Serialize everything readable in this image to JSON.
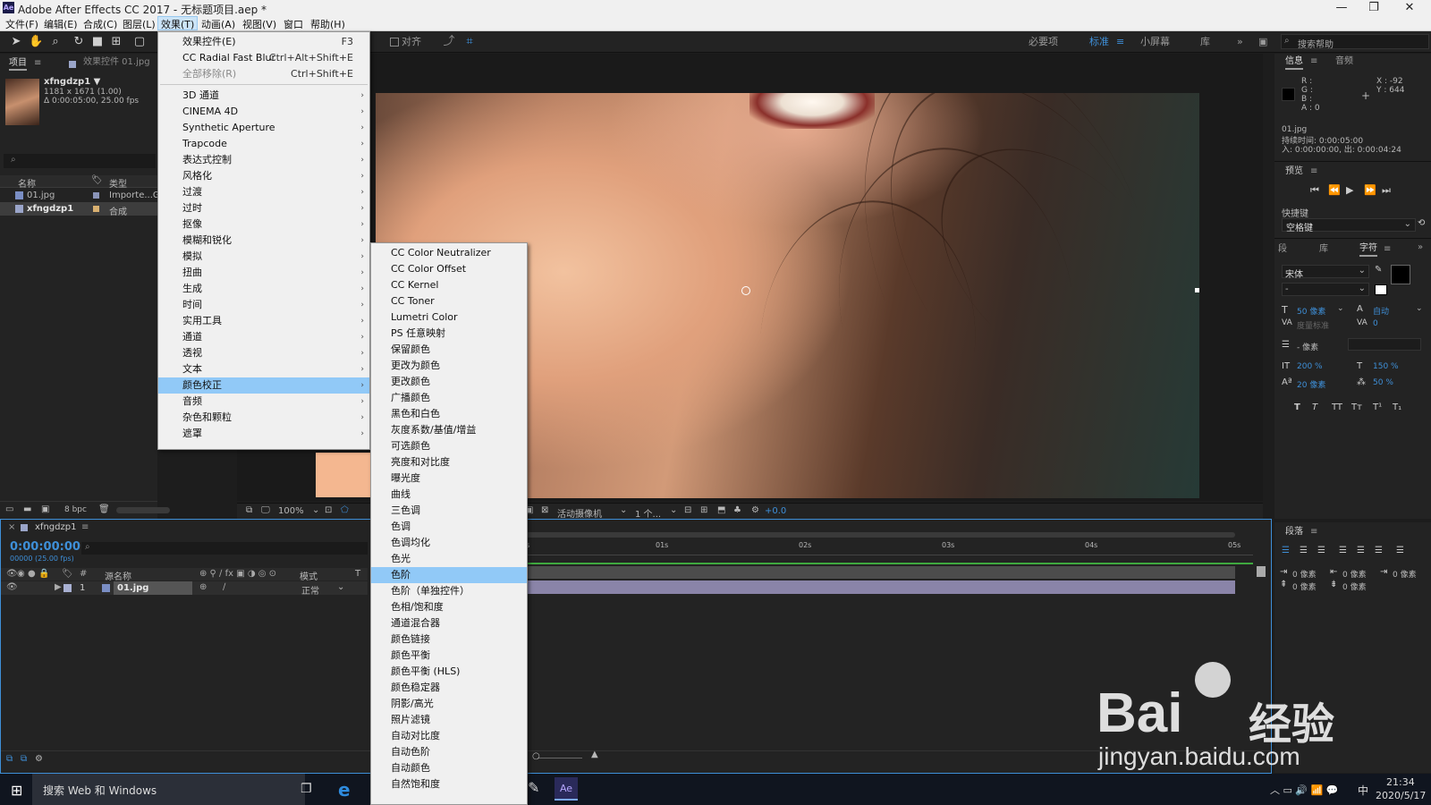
{
  "window": {
    "title": "Adobe After Effects CC 2017 - 无标题项目.aep *",
    "app_icon": "Ae",
    "min": "—",
    "max": "❐",
    "close": "✕"
  },
  "menubar": [
    "文件(F)",
    "编辑(E)",
    "合成(C)",
    "图层(L)",
    "效果(T)",
    "动画(A)",
    "视图(V)",
    "窗口",
    "帮助(H)"
  ],
  "toolbar": {
    "snap_label": "对齐",
    "workspaces": [
      "必要项",
      "标准",
      "小屏幕",
      "库"
    ],
    "search_help": "搜索帮助"
  },
  "project_panel": {
    "tab_project": "项目",
    "tab_effects": "效果控件 01.jpg",
    "thumb_name": "xfngdzp1 ▼",
    "thumb_info_1": "1181 x 1671 (1.00)",
    "thumb_info_2": "Δ 0:00:05:00, 25.00 fps",
    "col_name": "名称",
    "col_type": "类型",
    "rows": [
      {
        "name": "01.jpg",
        "type": "Importe...G"
      },
      {
        "name": "xfngdzp1",
        "type": "合成"
      }
    ],
    "bpc": "8 bpc"
  },
  "effects_menu": {
    "items": [
      {
        "label": "效果控件(E)",
        "shortcut": "F3"
      },
      {
        "label": "CC Radial Fast Blur",
        "shortcut": "Ctrl+Alt+Shift+E"
      },
      {
        "label": "全部移除(R)",
        "shortcut": "Ctrl+Shift+E"
      }
    ],
    "categories": [
      "3D 通道",
      "CINEMA 4D",
      "Synthetic Aperture",
      "Trapcode",
      "表达式控制",
      "风格化",
      "过渡",
      "过时",
      "抠像",
      "模糊和锐化",
      "模拟",
      "扭曲",
      "生成",
      "时间",
      "实用工具",
      "通道",
      "透视",
      "文本",
      "颜色校正",
      "音频",
      "杂色和颗粒",
      "遮罩"
    ],
    "highlighted": "颜色校正"
  },
  "color_correction_menu": {
    "items": [
      "CC Color Neutralizer",
      "CC Color Offset",
      "CC Kernel",
      "CC Toner",
      "Lumetri Color",
      "PS 任意映射",
      "保留颜色",
      "更改为颜色",
      "更改颜色",
      "广播颜色",
      "黑色和白色",
      "灰度系数/基值/增益",
      "可选颜色",
      "亮度和对比度",
      "曝光度",
      "曲线",
      "三色调",
      "色调",
      "色调均化",
      "色光",
      "色阶",
      "色阶（单独控件）",
      "色相/饱和度",
      "通道混合器",
      "颜色链接",
      "颜色平衡",
      "颜色平衡 (HLS)",
      "颜色稳定器",
      "阴影/高光",
      "照片滤镜",
      "自动对比度",
      "自动色阶",
      "自动颜色",
      "自然饱和度"
    ],
    "highlighted": "色阶"
  },
  "viewer_bar": {
    "zoom": "100%",
    "camera": "活动摄像机",
    "views": "1 个...",
    "exposure": "+0.0"
  },
  "info_panel": {
    "tab_info": "信息",
    "tab_audio": "音频",
    "r": "R :",
    "g": "G :",
    "b": "B :",
    "a": "A : 0",
    "x": "X : -92",
    "y": "Y : 644",
    "file": "01.jpg",
    "duration": "持续时间: 0:00:05:00",
    "in_out": "入: 0:00:00:00, 出: 0:00:04:24"
  },
  "preview_panel": {
    "title": "预览",
    "shortcut_label": "快捷键",
    "shortcut_value": "空格键"
  },
  "character_panel": {
    "tabs": [
      "段",
      "库",
      "字符"
    ],
    "font": "宋体",
    "style": "-",
    "size": "50 像素",
    "leading": "自动",
    "kerning": "度量标准",
    "tracking": "0",
    "stroke": "- 像素",
    "vscale": "200 %",
    "hscale": "150 %",
    "baseline": "20 像素",
    "tsume": "50 %",
    "styles": [
      "T",
      "T",
      "TT",
      "Tт",
      "T¹",
      "T₁"
    ]
  },
  "paragraph_panel": {
    "title": "段落",
    "indent_left": "0 像素",
    "indent_right": "0 像素",
    "indent_first": "0 像素",
    "space_before": "0 像素",
    "space_after": "0 像素"
  },
  "timeline": {
    "comp_tab": "xfngdzp1",
    "timecode": "0:00:00:00",
    "frames": "00000 (25.00 fps)",
    "col_source": "源名称",
    "col_mode": "模式",
    "col_t": "T",
    "layer_num": "1",
    "layer_name": "01.jpg",
    "layer_mode": "正常",
    "ruler": [
      "0s",
      "01s",
      "02s",
      "03s",
      "04s",
      "05s"
    ]
  },
  "taskbar": {
    "search": "搜索 Web 和 Windows",
    "time": "21:34",
    "date": "2020/5/17",
    "ime": "中"
  },
  "watermark": {
    "brand": "Bai",
    "brand_cn": "经验",
    "url": "jingyan.baidu.com"
  }
}
